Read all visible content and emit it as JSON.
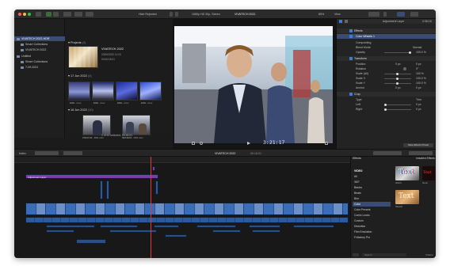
{
  "toolbar": {
    "hide_rejected": "Hide Rejected",
    "format": "1080p HD 30p, Stereo",
    "project_title": "VIVATECH 2022",
    "zoom": "89%",
    "view": "View",
    "time_right": "2:36:18",
    "adjust_layer": "Adjustment Layer"
  },
  "sidebar": {
    "items": [
      {
        "label": "VIVATECH 2022-HDR"
      },
      {
        "label": "Smart Collections"
      },
      {
        "label": "VIVATECH 2022"
      },
      {
        "label": "Untitled"
      },
      {
        "label": "Smart Collections"
      },
      {
        "label": "7-09-2021"
      }
    ]
  },
  "browser": {
    "projects_header": "Projects",
    "projects_count": "(1)",
    "project_name": "VIVATECH 2022",
    "project_date": "23/06/2022 11:15",
    "project_duration": "00:06:18:01",
    "groups": [
      {
        "date": "17 Jun 2022",
        "count": "(4)",
        "clips": [
          "EDE...mov",
          "EDE...mov",
          "EDE...mov",
          "EDE...mov"
        ]
      },
      {
        "date": "16 Jun 2022",
        "count": "(10)",
        "clips": [
          "F60AF36...D01.mov",
          "8E63E6F...D01.mov"
        ]
      }
    ],
    "status": "1 of 41 selected, 09:18:01"
  },
  "viewer": {
    "timecode": "3:21:17"
  },
  "inspector": {
    "effects": "Effects",
    "color_wheels": "Color Wheels 1",
    "compositing": "Compositing",
    "blend_mode": "Blend Mode",
    "blend_value": "Normal",
    "opacity": "Opacity",
    "opacity_value": "100.0 %",
    "transform": "Transform",
    "position": "Position",
    "position_x": "0 px",
    "position_y": "0 px",
    "rotation": "Rotation",
    "rotation_value": "0°",
    "scale_all": "Scale (All)",
    "scale_all_value": "100 %",
    "scale_x": "Scale X",
    "scale_x_value": "100.0 %",
    "scale_y": "Scale Y",
    "scale_y_value": "100.0 %",
    "anchor": "Anchor",
    "anchor_x": "0 px",
    "crop": "Crop",
    "crop_type": "Type",
    "crop_type_value": "Trim",
    "left": "Left",
    "left_value": "0 px",
    "right": "Right",
    "right_value": "0 px",
    "save_preset": "Save Effects Preset"
  },
  "timeline": {
    "index": "Index",
    "project": "VIVATECH 2022",
    "duration": "06:18:01",
    "title_clip": "Adjustment Layer"
  },
  "effects": {
    "header": "Effects",
    "installed": "Installed Effects",
    "categories": [
      "VIDEO",
      "All",
      "360°",
      "Basics",
      "Beats",
      "Blur",
      "Color",
      "Color Presets",
      "Comic Looks",
      "Custom",
      "Distortion",
      "Film Emulation",
      "Fxfactory Pro"
    ],
    "selected_category": "Color",
    "tiles": [
      {
        "label": "Glitch",
        "text": "Text"
      },
      {
        "label": "Neon",
        "text": "Text"
      },
      {
        "label": "Sketch",
        "text": "Text"
      }
    ],
    "search_placeholder": "Search",
    "count": "3 items"
  }
}
